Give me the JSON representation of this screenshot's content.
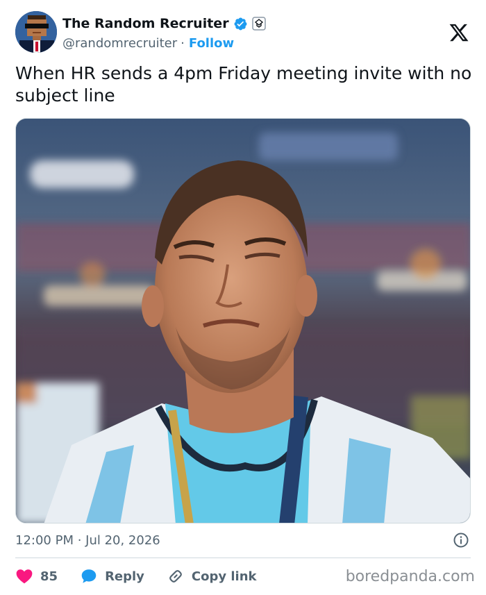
{
  "post": {
    "author": {
      "display_name": "The Random Recruiter",
      "handle": "@randomrecruiter",
      "separator": "·",
      "follow_label": "Follow",
      "verified": true
    },
    "platform_icon": "x-logo-icon",
    "text": "When HR sends a 4pm Friday meeting invite with no subject line",
    "timestamp": "12:00 PM · Jul 20, 2026",
    "actions": {
      "likes_count": "85",
      "reply_label": "Reply",
      "copy_link_label": "Copy link"
    }
  },
  "watermark": "boredpanda.com",
  "colors": {
    "accent": "#1d9bf0",
    "like": "#f91880",
    "text_primary": "#0f1419",
    "text_secondary": "#536471"
  },
  "icons": [
    "avatar",
    "verified-badge-icon",
    "affiliate-icon",
    "x-logo-icon",
    "info-icon",
    "heart-icon",
    "reply-bubble-icon",
    "link-icon"
  ]
}
